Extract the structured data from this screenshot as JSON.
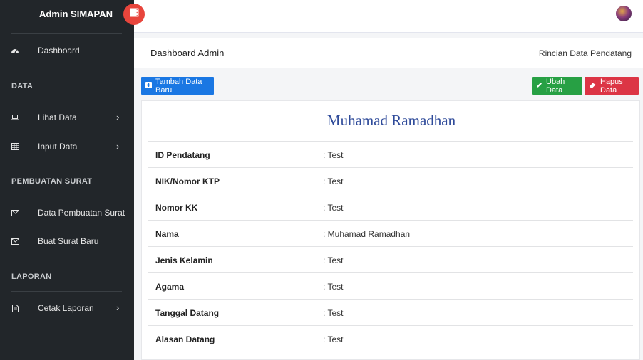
{
  "app": {
    "brand": "Admin SIMAPAN"
  },
  "sidebar": {
    "dashboard": "Dashboard",
    "section_data": "DATA",
    "lihat_data": "Lihat Data",
    "input_data": "Input Data",
    "section_surat": "PEMBUATAN SURAT",
    "data_pembuatan_surat": "Data Pembuatan Surat",
    "buat_surat_baru": "Buat Surat Baru",
    "section_laporan": "LAPORAN",
    "cetak_laporan": "Cetak Laporan"
  },
  "header": {
    "page_title": "Dashboard Admin",
    "breadcrumb": "Rincian Data Pendatang"
  },
  "actions": {
    "add": "Tambah Data Baru",
    "edit": "Ubah Data",
    "delete": "Hapus Data"
  },
  "detail": {
    "name_title": "Muhamad Ramadhan",
    "rows": [
      {
        "label": "ID Pendatang",
        "value": ": Test"
      },
      {
        "label": "NIK/Nomor KTP",
        "value": ": Test"
      },
      {
        "label": "Nomor KK",
        "value": ": Test"
      },
      {
        "label": "Nama",
        "value": ": Muhamad Ramadhan"
      },
      {
        "label": "Jenis Kelamin",
        "value": ": Test"
      },
      {
        "label": "Agama",
        "value": ": Test"
      },
      {
        "label": "Tanggal Datang",
        "value": ": Test"
      },
      {
        "label": "Alasan Datang",
        "value": ": Test"
      }
    ]
  },
  "colors": {
    "sidebar_bg": "#22262a",
    "toggle": "#e8453c",
    "primary": "#1a77e3",
    "success": "#27a044",
    "danger": "#dc3545",
    "title": "#2f4b9a"
  },
  "icons": {
    "dashboard": "dashboard-icon",
    "lihat": "laptop-icon",
    "input": "table-icon",
    "surat": "envelope-icon",
    "laporan": "file-icon",
    "toggle": "server-icon",
    "add": "plus-square-icon",
    "edit": "pencil-icon",
    "delete": "eraser-icon"
  }
}
